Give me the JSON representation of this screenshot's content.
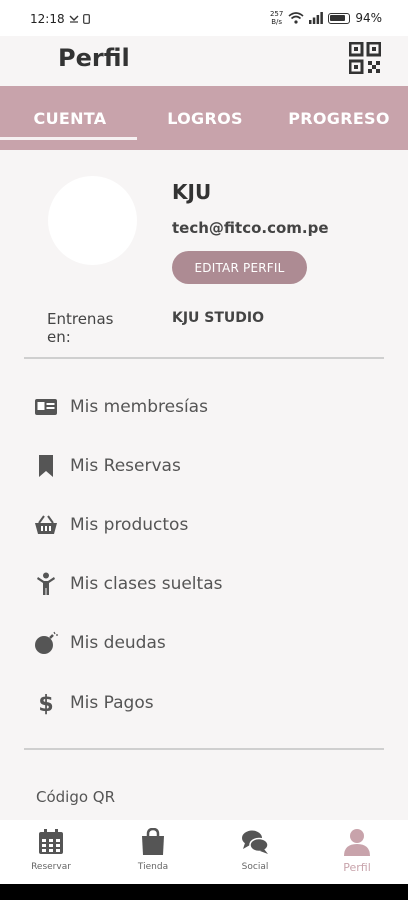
{
  "status_bar": {
    "time": "12:18",
    "net_speed_value": "257",
    "net_speed_unit": "B/s",
    "battery": "94%"
  },
  "header": {
    "title": "Perfil",
    "qr_icon": "qr-code-icon"
  },
  "tabs": [
    {
      "label": "CUENTA",
      "active": true
    },
    {
      "label": "LOGROS",
      "active": false
    },
    {
      "label": "PROGRESO",
      "active": false
    }
  ],
  "profile": {
    "name": "KJU",
    "email": "tech@fitco.com.pe",
    "edit_label": "EDITAR PERFIL",
    "trains_label": "Entrenas en:",
    "trains_value": "KJU STUDIO"
  },
  "menu": [
    {
      "label": "Mis membresías",
      "icon": "id-card-icon"
    },
    {
      "label": "Mis Reservas",
      "icon": "bookmark-icon"
    },
    {
      "label": "Mis productos",
      "icon": "basket-icon"
    },
    {
      "label": "Mis clases sueltas",
      "icon": "person-icon"
    },
    {
      "label": "Mis deudas",
      "icon": "bomb-icon"
    },
    {
      "label": "Mis Pagos",
      "icon": "dollar-icon"
    }
  ],
  "qr_section": {
    "label": "Código QR"
  },
  "bottom_nav": [
    {
      "label": "Reservar",
      "icon": "calendar-icon",
      "active": false
    },
    {
      "label": "Tienda",
      "icon": "shopping-bag-icon",
      "active": false
    },
    {
      "label": "Social",
      "icon": "chat-bubbles-icon",
      "active": false
    },
    {
      "label": "Perfil",
      "icon": "user-icon",
      "active": true
    }
  ],
  "colors": {
    "accent": "#c8a3ab",
    "button": "#ad8b93",
    "background": "#f7f5f5"
  }
}
